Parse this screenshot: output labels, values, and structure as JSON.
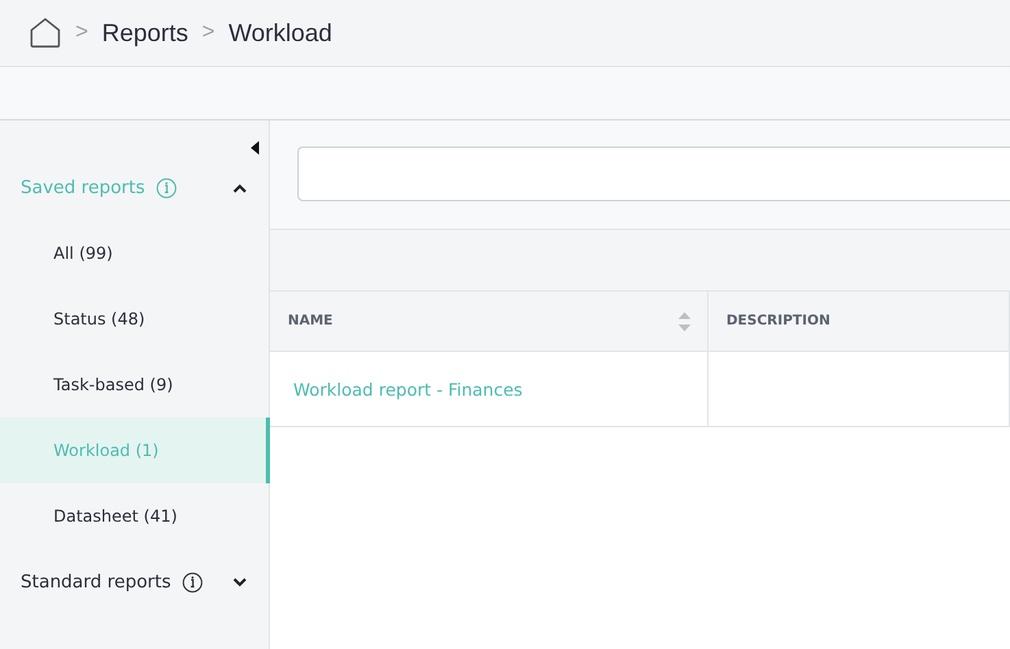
{
  "breadcrumb": [
    {
      "separator": ">",
      "label": "Reports"
    },
    {
      "separator": ">",
      "label": "Workload"
    }
  ],
  "sidebar": {
    "sections": [
      {
        "title": "Saved reports",
        "expanded": true,
        "selected": true,
        "items": [
          {
            "label": "All (99)",
            "selected": false
          },
          {
            "label": "Status (48)",
            "selected": false
          },
          {
            "label": "Task-based (9)",
            "selected": false
          },
          {
            "label": "Workload (1)",
            "selected": true
          },
          {
            "label": "Datasheet (41)",
            "selected": false
          }
        ]
      },
      {
        "title": "Standard reports",
        "expanded": false,
        "selected": false
      }
    ]
  },
  "table": {
    "columns": [
      {
        "label": "NAME",
        "sortable": true
      },
      {
        "label": "DESCRIPTION",
        "sortable": false
      }
    ],
    "rows": [
      {
        "cells": [
          "Workload report - Finances",
          ""
        ]
      }
    ]
  }
}
